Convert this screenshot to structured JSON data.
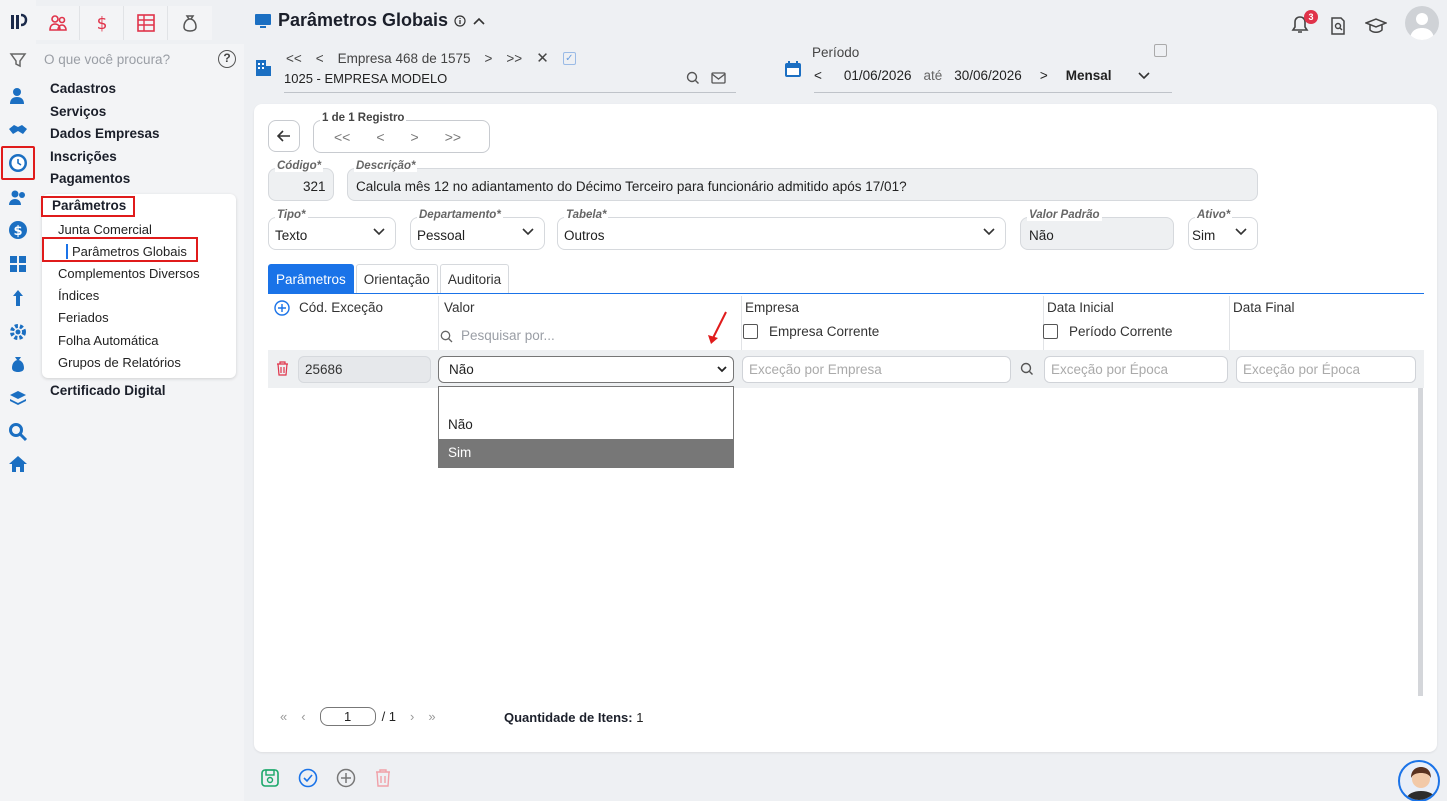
{
  "header": {
    "title": "Parâmetros Globais",
    "notifications_count": "3"
  },
  "empresa_nav": {
    "label": "Empresa 468 de 1575",
    "current": "1025 - EMPRESA MODELO"
  },
  "periodo": {
    "label": "Período",
    "start": "01/06/2026",
    "sep": "até",
    "end": "30/06/2026",
    "type": "Mensal"
  },
  "sidebar": {
    "search_placeholder": "O que você procura?",
    "help": "?",
    "sections": [
      "Cadastros",
      "Serviços",
      "Dados Empresas",
      "Inscrições",
      "Pagamentos",
      "Parâmetros"
    ],
    "sub_items": [
      "Junta Comercial",
      "Parâmetros Globais",
      "Complementos Diversos",
      "Índices",
      "Feriados",
      "Folha Automática",
      "Grupos de Relatórios"
    ],
    "after": "Certificado Digital"
  },
  "record_nav": {
    "legend": "1 de 1 Registro"
  },
  "form": {
    "codigo": {
      "label": "Código*",
      "value": "321"
    },
    "descricao": {
      "label": "Descrição*",
      "value": "Calcula mês 12 no adiantamento do Décimo Terceiro para funcionário admitido após 17/01?"
    },
    "tipo": {
      "label": "Tipo*",
      "value": "Texto"
    },
    "departamento": {
      "label": "Departamento*",
      "value": "Pessoal"
    },
    "tabela": {
      "label": "Tabela*",
      "value": "Outros"
    },
    "valor_padrao": {
      "label": "Valor Padrão",
      "value": "Não"
    },
    "ativo": {
      "label": "Ativo*",
      "value": "Sim"
    }
  },
  "tabs": [
    "Parâmetros",
    "Orientação",
    "Auditoria"
  ],
  "table": {
    "headers": [
      "Cód. Exceção",
      "Valor",
      "Empresa",
      "Data Inicial",
      "Data Final"
    ],
    "valor_search_placeholder": "Pesquisar por...",
    "empresa_corrente": "Empresa Corrente",
    "periodo_corrente": "Período Corrente",
    "row": {
      "cod": "25686",
      "valor": "Não",
      "empresa_placeholder": "Exceção por Empresa",
      "data_ini_placeholder": "Exceção por Época",
      "data_fim_placeholder": "Exceção por Época"
    },
    "dropdown_options": [
      "",
      "Não",
      "Sim"
    ],
    "dropdown_highlighted": "Sim"
  },
  "pager": {
    "page": "1",
    "total": "/ 1",
    "qtd_label": "Quantidade de Itens:",
    "qtd_value": "1"
  },
  "colors": {
    "accent": "#1a73e8",
    "highlight_box": "#e01b1b",
    "selected_option": "#777777"
  }
}
